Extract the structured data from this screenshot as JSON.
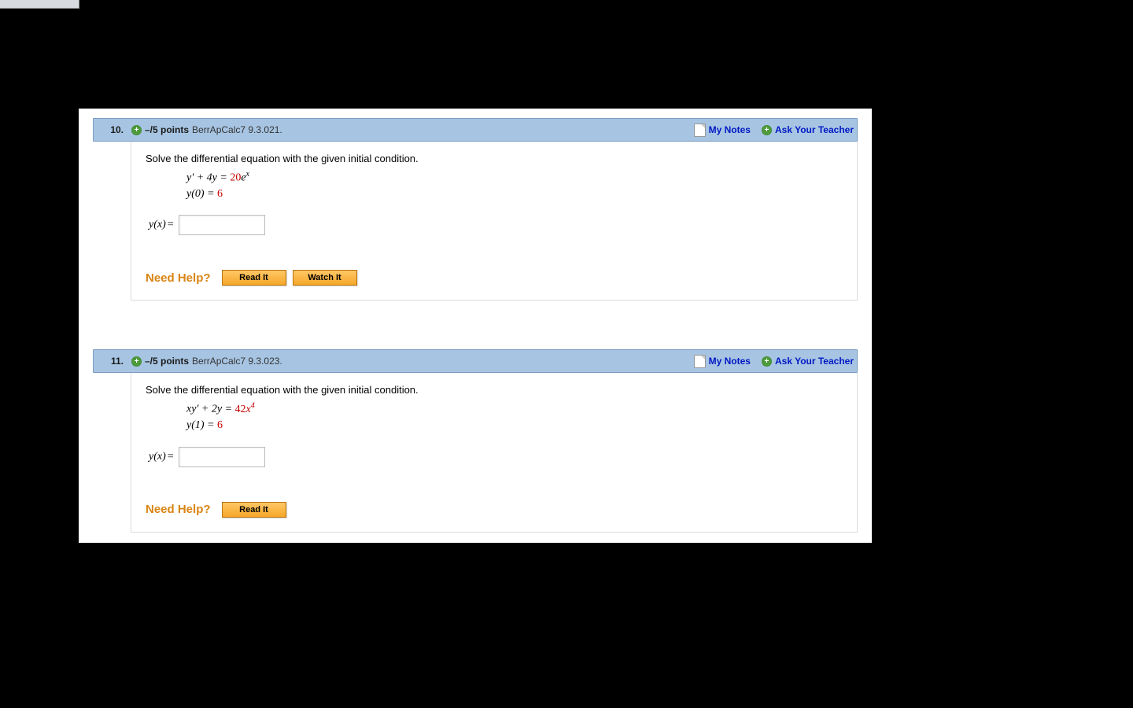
{
  "header": {
    "my_notes": "My Notes",
    "ask_teacher": "Ask Your Teacher",
    "plus_glyph": "+"
  },
  "questions": [
    {
      "number": "10.",
      "points": "–/5 points",
      "reference": "BerrApCalc7 9.3.021.",
      "instruction": "Solve the differential equation with the given initial condition.",
      "eq1_lhs": "y' + 4y = ",
      "eq1_coef": "20",
      "eq1_rhs_base": "e",
      "eq1_rhs_sup": "x",
      "eq2_lhs": "y(0) = ",
      "eq2_val": "6",
      "answer_label": "y(x)",
      "answer_eq": " = ",
      "need_help": "Need Help?",
      "buttons": [
        "Read It",
        "Watch It"
      ]
    },
    {
      "number": "11.",
      "points": "–/5 points",
      "reference": "BerrApCalc7 9.3.023.",
      "instruction": "Solve the differential equation with the given initial condition.",
      "eq1_lhs": "xy' + 2y = ",
      "eq1_coef": "42",
      "eq1_rhs_base": "x",
      "eq1_rhs_sup": "4",
      "eq2_lhs": "y(1) = ",
      "eq2_val": "6",
      "answer_label": "y(x)",
      "answer_eq": " = ",
      "need_help": "Need Help?",
      "buttons": [
        "Read It"
      ]
    }
  ]
}
